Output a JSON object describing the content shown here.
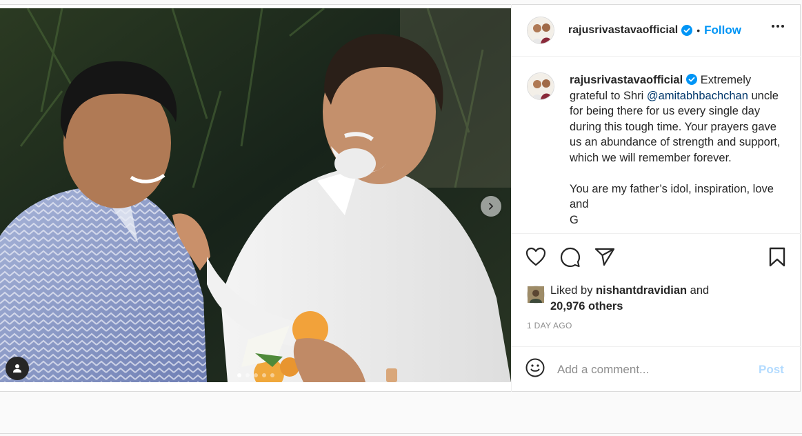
{
  "post": {
    "username": "rajusrivastavaofficial",
    "separator": "•",
    "follow_label": "Follow",
    "more_icon": "more-options-icon"
  },
  "caption": {
    "username": "rajusrivastavaofficial",
    "text_before_mention": " Extremely grateful to Shri ",
    "mention": "@amitabhbachchan",
    "text_after_mention": " uncle for being there for us every single day during this tough time. Your prayers gave us an abundance of strength and support, which we will remember forever.",
    "paragraph2": "You are my father’s idol, inspiration, love and",
    "cut_off": "G"
  },
  "actions": {
    "like_icon": "heart-icon",
    "comment_icon": "comment-icon",
    "share_icon": "paper-plane-icon",
    "save_icon": "bookmark-icon"
  },
  "likes": {
    "prefix": "Liked by ",
    "liker": "nishantdravidian",
    "and": " and",
    "others": "20,976 others"
  },
  "timestamp": "1 DAY AGO",
  "comment": {
    "placeholder": "Add a comment...",
    "post_label": "Post"
  },
  "carousel": {
    "slide_count": 5,
    "active_index": 0
  },
  "colors": {
    "follow_blue": "#0095f6",
    "post_disabled_blue": "#b3dbff",
    "mention_blue": "#00376b",
    "verified_blue": "#0095f6"
  }
}
